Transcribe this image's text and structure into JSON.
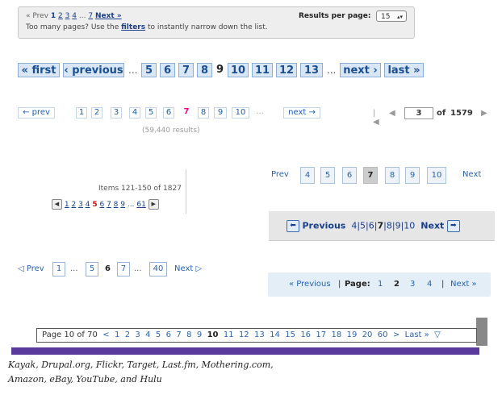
{
  "kayak": {
    "prev": "« Prev",
    "current": "1",
    "pages": [
      "2",
      "3",
      "4"
    ],
    "ellipsis": "...",
    "last": "7",
    "next": "Next »",
    "msg_before": "Too many pages? Use the",
    "filters": "filters",
    "msg_after": "to instantly narrow down the list.",
    "rpp_label": "Results per page:",
    "rpp_value": "15"
  },
  "drupal": {
    "first": "« first",
    "previous": "‹ previous",
    "ellipsis": "...",
    "pages_before": [
      "5",
      "6",
      "7",
      "8"
    ],
    "current": "9",
    "pages_after": [
      "10",
      "11",
      "12",
      "13"
    ],
    "next": "next ›",
    "last": "last »"
  },
  "flickr": {
    "prev": "← prev",
    "pages": [
      "1",
      "2",
      "3",
      "4",
      "5",
      "6",
      "7",
      "8",
      "9",
      "10"
    ],
    "current": "7",
    "ellipsis": "...",
    "next": "next →",
    "results": "(59,440 results)",
    "accent": "#ff0084"
  },
  "target": {
    "page_value": "3",
    "of_label": "of",
    "total": "1579"
  },
  "lastfm": {
    "items_text": "Items 121-150 of 1827",
    "pages_before": [
      "1",
      "2",
      "3",
      "4"
    ],
    "current": "5",
    "pages_after": [
      "6",
      "7",
      "8",
      "9"
    ],
    "ellipsis": "...",
    "last": "61"
  },
  "mothering": {
    "prev": "Prev",
    "pages": [
      "4",
      "5",
      "6",
      "7",
      "8",
      "9",
      "10"
    ],
    "current": "7",
    "next": "Next"
  },
  "amazon": {
    "previous": "Previous",
    "pages_before": [
      "4",
      "5",
      "6"
    ],
    "current": "7",
    "pages_after": [
      "8",
      "9",
      "10"
    ],
    "next": "Next"
  },
  "ebay": {
    "prev": "Prev",
    "first": "1",
    "ellipsis1": "...",
    "p5": "5",
    "current": "6",
    "p7": "7",
    "ellipsis2": "...",
    "last": "40",
    "next": "Next"
  },
  "youtube": {
    "previous": "« Previous",
    "page_label": "Page:",
    "pages": [
      "1",
      "2",
      "3",
      "4"
    ],
    "current": "2",
    "next": "Next »"
  },
  "hulu": {
    "page_text": "Page 10 of 70",
    "prev": "<",
    "pages": [
      "1",
      "2",
      "3",
      "4",
      "5",
      "6",
      "7",
      "8",
      "9",
      "10",
      "11",
      "12",
      "13",
      "14",
      "15",
      "16",
      "17",
      "18",
      "19",
      "20",
      "60"
    ],
    "current": "10",
    "next": ">",
    "last": "Last »"
  },
  "caption": {
    "line1": "Kayak, Drupal.org, Flickr, Target, Last.fm, Mothering.com,",
    "line2": "Amazon, eBay, YouTube, and Hulu"
  }
}
